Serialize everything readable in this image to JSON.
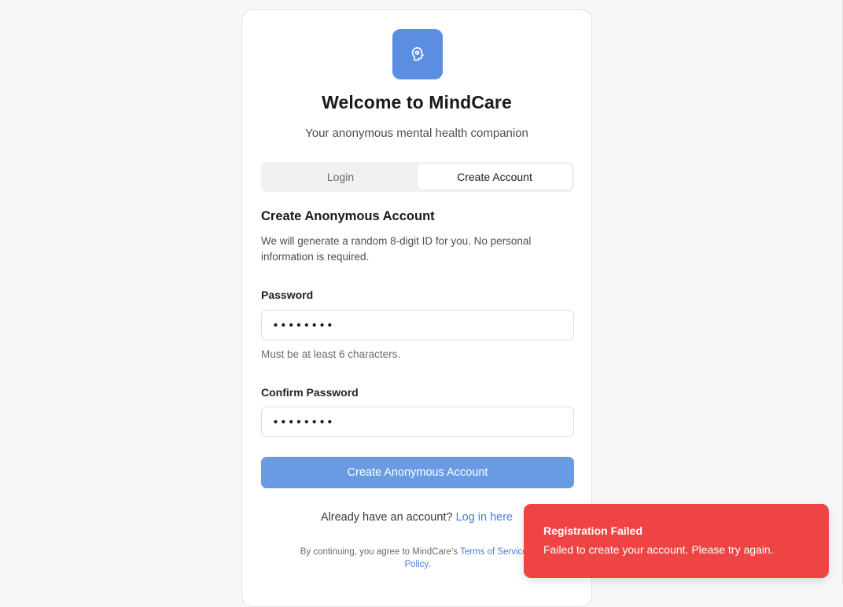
{
  "colors": {
    "accent": "#5b8ee0",
    "button": "#6a9be2",
    "link": "#4a7fd6",
    "toast_bg": "#ef4444"
  },
  "brand": {
    "logo_icon": "brain-head-icon",
    "title": "Welcome to MindCare",
    "subtitle": "Your anonymous mental health companion"
  },
  "tabs": [
    {
      "label": "Login",
      "active": false
    },
    {
      "label": "Create Account",
      "active": true
    }
  ],
  "form": {
    "heading": "Create Anonymous Account",
    "description": "We will generate a random 8-digit ID for you. No personal information is required.",
    "password_label": "Password",
    "password_value": "12345678",
    "password_hint": "Must be at least 6 characters.",
    "confirm_label": "Confirm Password",
    "confirm_value": "12345678",
    "submit_label": "Create Anonymous Account"
  },
  "switch": {
    "prompt": "Already have an account?",
    "link": "Log in here"
  },
  "legal": {
    "prefix": "By continuing, you agree to MindCare's ",
    "terms": "Terms of Service",
    "middle": " a",
    "policy": "Policy",
    "suffix": "."
  },
  "toast": {
    "title": "Registration Failed",
    "message": "Failed to create your account. Please try again."
  }
}
